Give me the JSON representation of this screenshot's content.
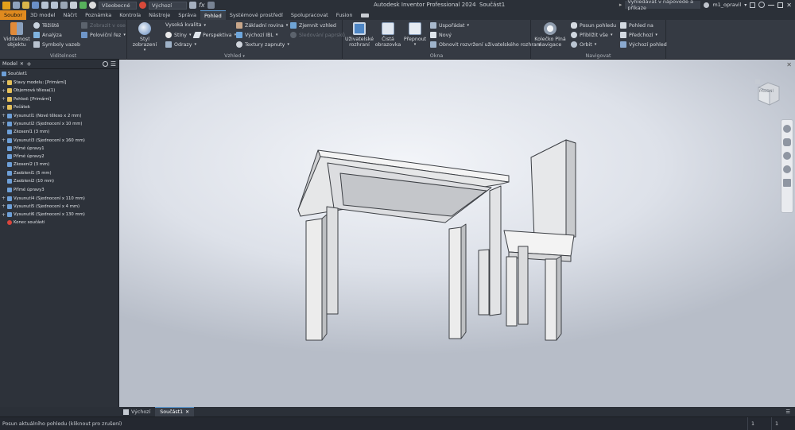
{
  "app": {
    "title": "Autodesk Inventor Professional 2024",
    "document": "Součást1"
  },
  "quick_access": {
    "appearance": "Všeobecné",
    "material": "Výchozí",
    "search_placeholder": "Vyhledávat v nápovědě a příkaze",
    "user": "m1_opravil",
    "fx": "fx"
  },
  "tabs": [
    "Soubor",
    "3D model",
    "Náčrt",
    "Poznámka",
    "Kontrola",
    "Nástroje",
    "Správa",
    "Pohled",
    "Systémové prostředí",
    "Spolupracovat",
    "Fusion"
  ],
  "ribbon": {
    "visibility": {
      "label": "Viditelnost",
      "object_visibility": "Viditelnost objektu",
      "centroid": "Těžiště",
      "analysis": "Analýza",
      "constraint_symbols": "Symboly vazeb",
      "zoom_to_axis": "Zobrazit v ose",
      "half_section": "Poloviční řez"
    },
    "appearance": {
      "label": "Vzhled",
      "visual_style": "Styl zobrazení",
      "high_quality": "Vysoká kvalita",
      "shadows": "Stíny",
      "reflections": "Odrazy",
      "perspective": "Perspektiva",
      "ground_plane": "Základní rovina",
      "default_ibl": "Výchozí IBL",
      "textures_on": "Textury zapnuty",
      "realistic_appearance": "Zjemnit vzhled",
      "ray_tracing": "Sledování paprsků"
    },
    "windows": {
      "label": "Okna",
      "user_interface": "Uživatelské rozhraní",
      "clean_screen": "Čistá obrazovka",
      "switch": "Přepnout",
      "arrange": "Uspořádat",
      "new": "Nový",
      "restore_layout": "Obnovit rozvržení uživatelského rozhraní"
    },
    "navigate": {
      "label": "Navigovat",
      "steering_wheels": "Kolečko Plná navigace",
      "pan": "Posun pohledu",
      "zoom_all": "Přiblížit vše",
      "orbit": "Orbit",
      "look_at": "Pohled na",
      "previous": "Předchozí",
      "home_view": "Výchozí pohled"
    }
  },
  "browser": {
    "tab": "Model",
    "items": [
      {
        "label": "Součást1",
        "icon": "part"
      },
      {
        "label": "Stavy modelu: [Primární]",
        "icon": "folder",
        "exp": "+"
      },
      {
        "label": "Objemová tělesa(1)",
        "icon": "folder",
        "exp": "+"
      },
      {
        "label": "Pohled: [Primární]",
        "icon": "folder",
        "exp": "+"
      },
      {
        "label": "Počátek",
        "icon": "folder",
        "exp": "+"
      },
      {
        "label": "Vysunutí1 (Nové těleso x 2 mm)",
        "icon": "feature",
        "exp": "+"
      },
      {
        "label": "Vysunutí2 (Sjednocení x 10 mm)",
        "icon": "feature",
        "exp": "+"
      },
      {
        "label": "Zkosení1 (3 mm)",
        "icon": "feature",
        "exp": ""
      },
      {
        "label": "Vysunutí3 (Sjednocení x 160 mm)",
        "icon": "feature",
        "exp": "+"
      },
      {
        "label": "Přímé úpravy1",
        "icon": "feature",
        "exp": ""
      },
      {
        "label": "Přímé úpravy2",
        "icon": "feature",
        "exp": ""
      },
      {
        "label": "Zkosení2 (3 mm)",
        "icon": "feature",
        "exp": ""
      },
      {
        "label": "Zaoblení1 (5 mm)",
        "icon": "feature",
        "exp": ""
      },
      {
        "label": "Zaoblení2 (10 mm)",
        "icon": "feature",
        "exp": ""
      },
      {
        "label": "Přímé úpravy3",
        "icon": "feature",
        "exp": ""
      },
      {
        "label": "Vysunutí4 (Sjednocení x 110 mm)",
        "icon": "feature",
        "exp": "+"
      },
      {
        "label": "Vysunutí5 (Sjednocení x 4 mm)",
        "icon": "feature",
        "exp": "+"
      },
      {
        "label": "Vysunutí6 (Sjednocení x 130 mm)",
        "icon": "feature",
        "exp": "+"
      },
      {
        "label": "Konec součásti",
        "icon": "end",
        "exp": ""
      }
    ]
  },
  "viewcube": {
    "face": "PŘEDNÍ"
  },
  "doc_tabs": {
    "home": "Výchozí",
    "doc": "Součást1"
  },
  "status": {
    "message": "Posun aktuálního pohledu (kliknout pro zrušení)",
    "count1": "1",
    "count2": "1"
  }
}
